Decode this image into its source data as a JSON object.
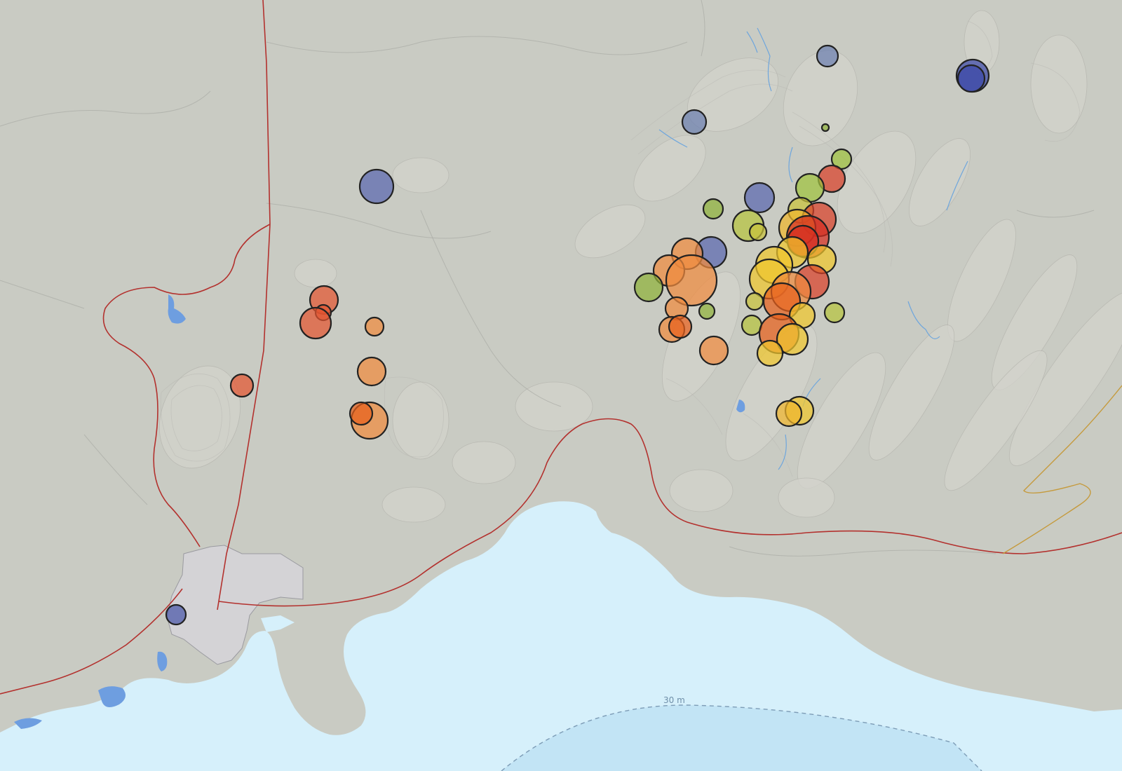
{
  "map": {
    "depth_contour_label": "30 m",
    "colors": {
      "land": "#c9cbc3",
      "sea": "#d6f0fb",
      "deep_sea": "#c2e4f5",
      "town": "#d4d3d6",
      "road": "#b3312e",
      "lake": "#6e9ee0"
    },
    "legend_colors_by_recency": [
      "#d62d20",
      "#e8601c",
      "#f08a3e",
      "#f0c62c",
      "#9fc23e",
      "#6c7fb0",
      "#3c48a8"
    ],
    "earthquakes": [
      {
        "lon": 1180,
        "lat": 80,
        "mag": 15,
        "color": "#6c7fb0"
      },
      {
        "lon": 1387,
        "lat": 108,
        "mag": 23,
        "color": "#3c48a8"
      },
      {
        "lon": 1385,
        "lat": 112,
        "mag": 19,
        "color": "#3c48a8"
      },
      {
        "lon": 990,
        "lat": 174,
        "mag": 17,
        "color": "#6c7fb0"
      },
      {
        "lon": 1177,
        "lat": 182,
        "mag": 5,
        "color": "#8fb23a"
      },
      {
        "lon": 537,
        "lat": 266,
        "mag": 24,
        "color": "#5a66b0"
      },
      {
        "lon": 1200,
        "lat": 227,
        "mag": 14,
        "color": "#9fc23e"
      },
      {
        "lon": 1186,
        "lat": 255,
        "mag": 19,
        "color": "#d9402a"
      },
      {
        "lon": 1155,
        "lat": 268,
        "mag": 20,
        "color": "#9fc23e"
      },
      {
        "lon": 1083,
        "lat": 282,
        "mag": 21,
        "color": "#5a66b0"
      },
      {
        "lon": 1017,
        "lat": 298,
        "mag": 14,
        "color": "#8fb23a"
      },
      {
        "lon": 1142,
        "lat": 300,
        "mag": 18,
        "color": "#c9c23c"
      },
      {
        "lon": 1067,
        "lat": 322,
        "mag": 22,
        "color": "#b7c33e"
      },
      {
        "lon": 1081,
        "lat": 331,
        "mag": 12,
        "color": "#c9c23c"
      },
      {
        "lon": 1168,
        "lat": 313,
        "mag": 24,
        "color": "#d9402a"
      },
      {
        "lon": 1137,
        "lat": 325,
        "mag": 26,
        "color": "#f0b52c"
      },
      {
        "lon": 1152,
        "lat": 338,
        "mag": 30,
        "color": "#d62d20"
      },
      {
        "lon": 1145,
        "lat": 344,
        "mag": 22,
        "color": "#d62d20"
      },
      {
        "lon": 1130,
        "lat": 360,
        "mag": 22,
        "color": "#f0c62c"
      },
      {
        "lon": 1172,
        "lat": 370,
        "mag": 20,
        "color": "#f0c62c"
      },
      {
        "lon": 1014,
        "lat": 360,
        "mag": 22,
        "color": "#5a66b0"
      },
      {
        "lon": 980,
        "lat": 362,
        "mag": 22,
        "color": "#f08a3e"
      },
      {
        "lon": 954,
        "lat": 386,
        "mag": 22,
        "color": "#f08a3e"
      },
      {
        "lon": 986,
        "lat": 400,
        "mag": 36,
        "color": "#f08a3e"
      },
      {
        "lon": 925,
        "lat": 410,
        "mag": 20,
        "color": "#8fb23a"
      },
      {
        "lon": 1104,
        "lat": 378,
        "mag": 26,
        "color": "#f0c62c"
      },
      {
        "lon": 1097,
        "lat": 398,
        "mag": 28,
        "color": "#f0c62c"
      },
      {
        "lon": 1158,
        "lat": 402,
        "mag": 24,
        "color": "#d9402a"
      },
      {
        "lon": 1128,
        "lat": 416,
        "mag": 28,
        "color": "#f08a3e"
      },
      {
        "lon": 1115,
        "lat": 430,
        "mag": 26,
        "color": "#e8601c"
      },
      {
        "lon": 1076,
        "lat": 430,
        "mag": 12,
        "color": "#c9c23c"
      },
      {
        "lon": 1190,
        "lat": 446,
        "mag": 14,
        "color": "#b7c33e"
      },
      {
        "lon": 1144,
        "lat": 450,
        "mag": 18,
        "color": "#f0c62c"
      },
      {
        "lon": 965,
        "lat": 440,
        "mag": 16,
        "color": "#f08a3e"
      },
      {
        "lon": 1008,
        "lat": 444,
        "mag": 11,
        "color": "#8fb23a"
      },
      {
        "lon": 1072,
        "lat": 464,
        "mag": 14,
        "color": "#b7c33e"
      },
      {
        "lon": 958,
        "lat": 470,
        "mag": 18,
        "color": "#f08a3e"
      },
      {
        "lon": 970,
        "lat": 466,
        "mag": 16,
        "color": "#e8601c"
      },
      {
        "lon": 1111,
        "lat": 476,
        "mag": 28,
        "color": "#e8601c"
      },
      {
        "lon": 1130,
        "lat": 484,
        "mag": 22,
        "color": "#f0c62c"
      },
      {
        "lon": 1018,
        "lat": 500,
        "mag": 20,
        "color": "#f08a3e"
      },
      {
        "lon": 1098,
        "lat": 504,
        "mag": 18,
        "color": "#f0c62c"
      },
      {
        "lon": 462,
        "lat": 428,
        "mag": 20,
        "color": "#e35530"
      },
      {
        "lon": 461,
        "lat": 446,
        "mag": 11,
        "color": "#e35530"
      },
      {
        "lon": 450,
        "lat": 461,
        "mag": 22,
        "color": "#e35530"
      },
      {
        "lon": 534,
        "lat": 466,
        "mag": 13,
        "color": "#f08a3e"
      },
      {
        "lon": 530,
        "lat": 530,
        "mag": 20,
        "color": "#f08a3e"
      },
      {
        "lon": 527,
        "lat": 600,
        "mag": 26,
        "color": "#f08a3e"
      },
      {
        "lon": 515,
        "lat": 590,
        "mag": 16,
        "color": "#e8601c"
      },
      {
        "lon": 345,
        "lat": 550,
        "mag": 16,
        "color": "#e35530"
      },
      {
        "lon": 1140,
        "lat": 586,
        "mag": 20,
        "color": "#f0c62c"
      },
      {
        "lon": 1125,
        "lat": 590,
        "mag": 18,
        "color": "#f0b52c"
      },
      {
        "lon": 251,
        "lat": 877,
        "mag": 14,
        "color": "#4a56a8"
      }
    ]
  }
}
